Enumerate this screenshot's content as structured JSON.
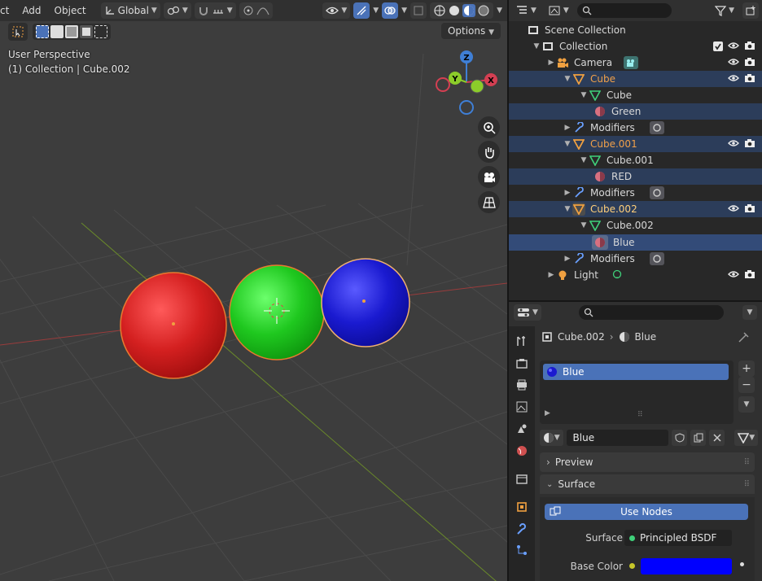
{
  "viewport": {
    "menu": [
      "ct",
      "Add",
      "Object"
    ],
    "orientation": "Global",
    "options_label": "Options",
    "perspective_label": "User Perspective",
    "collection_path": "(1) Collection | Cube.002",
    "gizmo_axes": {
      "z": "Z",
      "y": "Y",
      "x": "X"
    },
    "objects": [
      {
        "name": "red-sphere",
        "color": "#d42020"
      },
      {
        "name": "green-sphere",
        "color": "#1fc81f"
      },
      {
        "name": "blue-sphere",
        "color": "#1a1ad0"
      }
    ]
  },
  "outliner": {
    "scene_collection": "Scene Collection",
    "collection": "Collection",
    "rows": [
      {
        "label": "Camera",
        "level": 2,
        "type": "camera"
      },
      {
        "label": "Cube",
        "level": 2,
        "type": "mesh-object"
      },
      {
        "label": "Cube",
        "level": 3,
        "type": "mesh-data"
      },
      {
        "label": "Green",
        "level": 4,
        "type": "material"
      },
      {
        "label": "Modifiers",
        "level": 3,
        "type": "modifiers"
      },
      {
        "label": "Cube.001",
        "level": 2,
        "type": "mesh-object"
      },
      {
        "label": "Cube.001",
        "level": 3,
        "type": "mesh-data"
      },
      {
        "label": "RED",
        "level": 4,
        "type": "material"
      },
      {
        "label": "Modifiers",
        "level": 3,
        "type": "modifiers"
      },
      {
        "label": "Cube.002",
        "level": 2,
        "type": "mesh-object"
      },
      {
        "label": "Cube.002",
        "level": 3,
        "type": "mesh-data"
      },
      {
        "label": "Blue",
        "level": 4,
        "type": "material"
      },
      {
        "label": "Modifiers",
        "level": 3,
        "type": "modifiers"
      },
      {
        "label": "Light",
        "level": 2,
        "type": "light"
      }
    ]
  },
  "properties": {
    "breadcrumb_object": "Cube.002",
    "breadcrumb_material": "Blue",
    "slot_name": "Blue",
    "material_name": "Blue",
    "preview_label": "Preview",
    "surface_panel_label": "Surface",
    "use_nodes_label": "Use Nodes",
    "surface_label": "Surface",
    "surface_value": "Principled BSDF",
    "base_color_label": "Base Color",
    "base_color": "#0000ff"
  },
  "colors": {
    "accent": "#4a72b8",
    "selected_text": "#f0a04a",
    "active_text": "#ffcf7a"
  }
}
